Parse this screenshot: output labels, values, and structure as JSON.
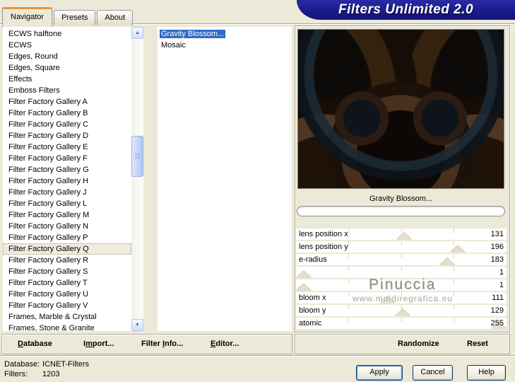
{
  "window": {
    "title": "Filters Unlimited 2.0"
  },
  "tabs": {
    "items": [
      {
        "label": "Navigator",
        "selected": true
      },
      {
        "label": "Presets"
      },
      {
        "label": "About"
      }
    ]
  },
  "categories": {
    "items": [
      {
        "label": "ECWS halftone"
      },
      {
        "label": "ECWS"
      },
      {
        "label": "Edges, Round"
      },
      {
        "label": "Edges, Square"
      },
      {
        "label": "Effects"
      },
      {
        "label": "Emboss Filters"
      },
      {
        "label": "Filter Factory Gallery A"
      },
      {
        "label": "Filter Factory Gallery B"
      },
      {
        "label": "Filter Factory Gallery C"
      },
      {
        "label": "Filter Factory Gallery D"
      },
      {
        "label": "Filter Factory Gallery E"
      },
      {
        "label": "Filter Factory Gallery F"
      },
      {
        "label": "Filter Factory Gallery G"
      },
      {
        "label": "Filter Factory Gallery H"
      },
      {
        "label": "Filter Factory Gallery J"
      },
      {
        "label": "Filter Factory Gallery L"
      },
      {
        "label": "Filter Factory Gallery M"
      },
      {
        "label": "Filter Factory Gallery N"
      },
      {
        "label": "Filter Factory Gallery P"
      },
      {
        "label": "Filter Factory Gallery Q",
        "selected": true
      },
      {
        "label": "Filter Factory Gallery R"
      },
      {
        "label": "Filter Factory Gallery S"
      },
      {
        "label": "Filter Factory Gallery T"
      },
      {
        "label": "Filter Factory Gallery U"
      },
      {
        "label": "Filter Factory Gallery V"
      },
      {
        "label": "Frames, Marble & Crystal"
      },
      {
        "label": "Frames, Stone & Granite"
      }
    ]
  },
  "filters": {
    "items": [
      {
        "label": "Gravity Blossom...",
        "selected": true
      },
      {
        "label": "Mosaic"
      }
    ]
  },
  "preview": {
    "label": "Gravity Blossom...",
    "progress_percent": 0
  },
  "sliders": {
    "max": 255,
    "rows": [
      {
        "label": "lens position x",
        "value": 131
      },
      {
        "label": "lens position y",
        "value": 196
      },
      {
        "label": "e-radius",
        "value": 183
      },
      {
        "label": "",
        "value": 1
      },
      {
        "label": "",
        "value": 1
      },
      {
        "label": "bloom x",
        "value": 111
      },
      {
        "label": "bloom y",
        "value": 129
      },
      {
        "label": "atomic",
        "value": 255
      }
    ]
  },
  "watermark": {
    "line1": "Pinuccia",
    "line2": "www.moidiregrafica.eu"
  },
  "menus": {
    "left": {
      "items": [
        {
          "pre": "",
          "key": "D",
          "post": "atabase"
        },
        {
          "pre": "I",
          "key": "m",
          "post": "port..."
        },
        {
          "pre": "Filter ",
          "key": "I",
          "post": "nfo..."
        },
        {
          "pre": "",
          "key": "E",
          "post": "ditor..."
        }
      ]
    },
    "right": {
      "items": [
        {
          "pre": "Randomize",
          "key": "",
          "post": ""
        },
        {
          "pre": "Reset",
          "key": "",
          "post": ""
        }
      ]
    }
  },
  "statusbar": {
    "database_label": "Database:",
    "database_value": "ICNET-Filters",
    "filters_label": "Filters:",
    "filters_value": "1203"
  },
  "buttons": {
    "apply": "Apply",
    "cancel": "Cancel",
    "help": "Help"
  },
  "icons": {
    "scroll_up": "▲",
    "scroll_down": "▼"
  },
  "colors": {
    "window_bg": "#ece9d8",
    "banner": "#1b1b8c",
    "selection_blue": "#316ac5",
    "tab_highlight": "#e5973b"
  }
}
